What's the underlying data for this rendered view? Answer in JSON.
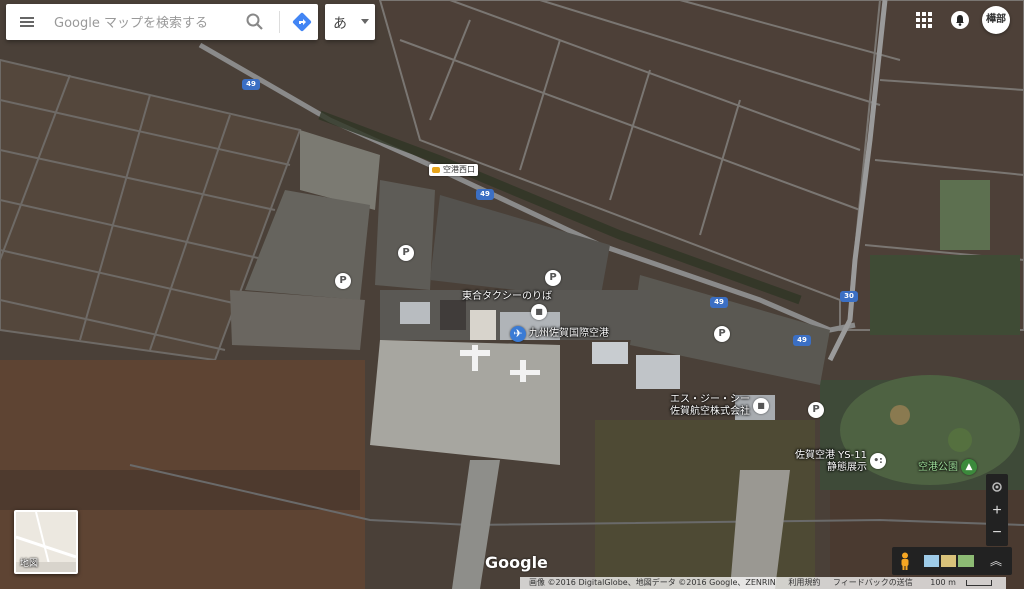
{
  "search": {
    "placeholder": "Google マップを検索する"
  },
  "ime": {
    "label": "あ"
  },
  "account": {
    "avatar_text": "樺部"
  },
  "map_labels": {
    "taxi_stand": "東合タクシーのりば",
    "airport": "九州佐賀国際空港",
    "company_line1": "エス・ジー・シー",
    "company_line2": "佐賀航空株式会社",
    "ys11_line1": "佐賀空港 YS-11",
    "ys11_line2": "静態展示",
    "park": "空港公園",
    "bus_stop": "空港西口"
  },
  "route_shields": {
    "r49_a": "49",
    "r49_b": "49",
    "r49_c": "49",
    "r49_d": "49",
    "r30": "30"
  },
  "parking_label": "P",
  "zoom": {
    "in": "+",
    "out": "−"
  },
  "minimap": {
    "label": "地図"
  },
  "brand": "Google",
  "footer": {
    "imagery": "画像 ©2016 DigitalGlobe、地図データ ©2016 Google、ZENRIN",
    "terms": "利用規約",
    "feedback": "フィードバックの送信",
    "scale": "100 m"
  }
}
